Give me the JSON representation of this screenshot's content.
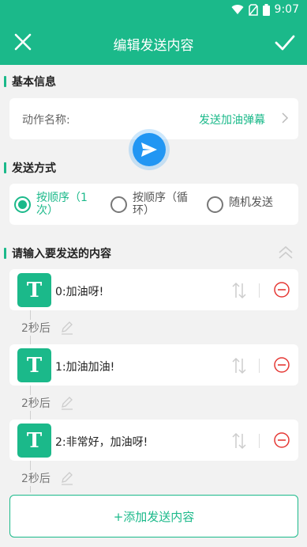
{
  "status_bar": {
    "time": "9:07"
  },
  "app_bar": {
    "title": "编辑发送内容"
  },
  "basic_info": {
    "section_title": "基本信息",
    "name_label": "动作名称:",
    "name_value": "发送加油弹幕"
  },
  "send_mode": {
    "section_title": "发送方式",
    "options": [
      {
        "label_line1": "按顺序（1",
        "label_line2": "次）",
        "selected": true
      },
      {
        "label_line1": "按顺序（循",
        "label_line2": "环）",
        "selected": false
      },
      {
        "label_line1": "随机发送",
        "label_line2": "",
        "selected": false
      }
    ]
  },
  "content": {
    "section_title": "请输入要发送的内容",
    "items": [
      {
        "avatar_letter": "T",
        "text": "0:加油呀!",
        "delay": "2秒后"
      },
      {
        "avatar_letter": "T",
        "text": "1:加油加油!",
        "delay": "2秒后"
      },
      {
        "avatar_letter": "T",
        "text": "2:非常好，加油呀!",
        "delay": "2秒后"
      }
    ],
    "add_button_label": "+添加发送内容"
  },
  "colors": {
    "primary": "#1bb98a",
    "fab": "#2196f3",
    "remove": "#e53935"
  }
}
